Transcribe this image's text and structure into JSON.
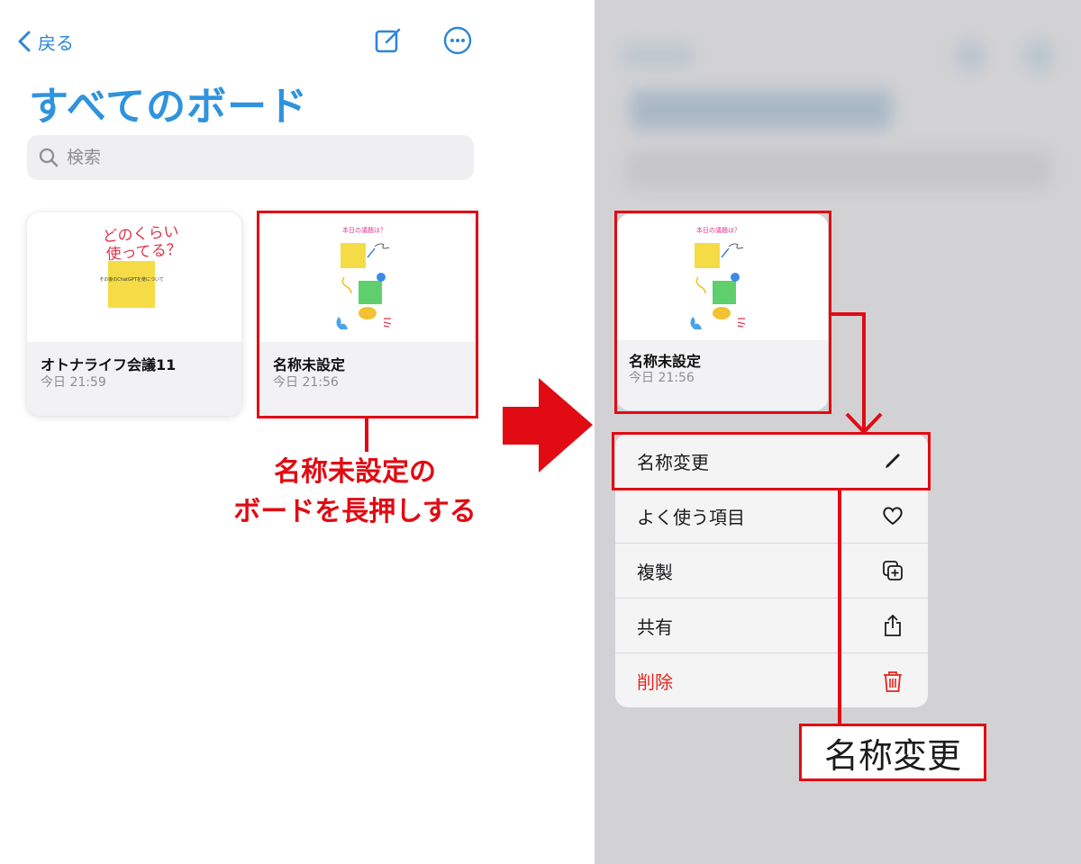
{
  "nav": {
    "back_label": "戻る"
  },
  "page": {
    "title": "すべてのボード"
  },
  "search": {
    "placeholder": "検索"
  },
  "boards": [
    {
      "name": "オトナライフ会議11",
      "time": "今日 21:59",
      "thumb_text_1": "どのくらい",
      "thumb_text_2": "使ってる？",
      "sticky_text": "その後のChatGPTを使について"
    },
    {
      "name": "名称未設定",
      "time": "今日 21:56",
      "thumb_heading": "本日の議題は？"
    }
  ],
  "annotation": {
    "line1": "名称未設定の",
    "line2": "ボードを長押しする"
  },
  "preview": {
    "name": "名称未設定",
    "time": "今日 21:56",
    "thumb_heading": "本日の議題は？"
  },
  "context_menu": {
    "items": [
      {
        "label": "名称変更",
        "icon": "pencil-icon"
      },
      {
        "label": "よく使う項目",
        "icon": "heart-icon"
      },
      {
        "label": "複製",
        "icon": "duplicate-icon"
      },
      {
        "label": "共有",
        "icon": "share-icon"
      },
      {
        "label": "削除",
        "icon": "trash-icon"
      }
    ]
  },
  "zoom_label": "名称変更",
  "colors": {
    "accent": "#2f93dd",
    "annotation_red": "#e10b13",
    "destructive": "#e5251b",
    "dim_bg": "#d2d2d5"
  }
}
